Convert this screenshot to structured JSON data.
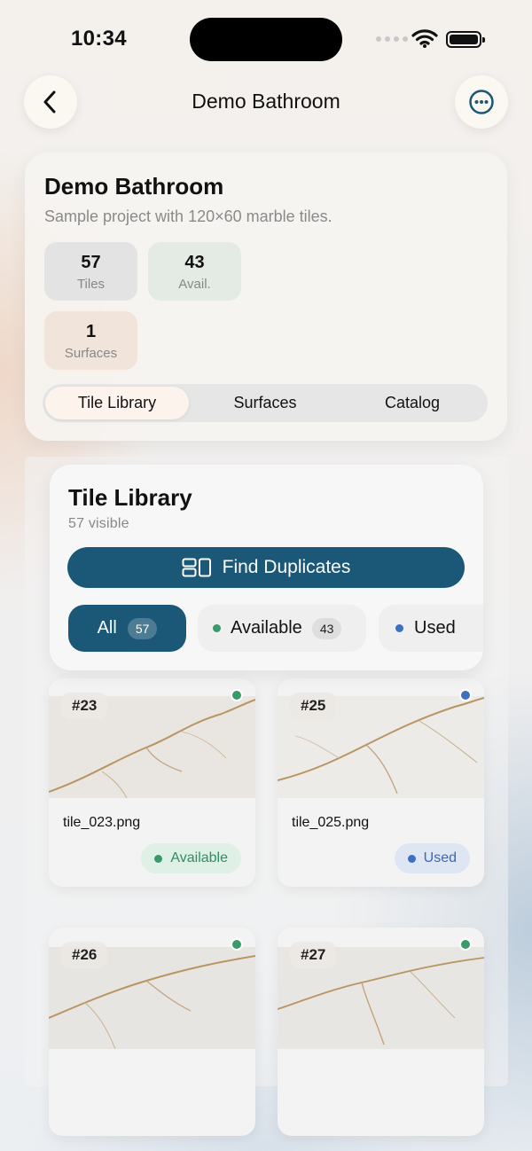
{
  "status_bar": {
    "time": "10:34"
  },
  "nav": {
    "title": "Demo Bathroom",
    "back_icon": "chevron-left-icon",
    "more_icon": "ellipsis-circle-icon"
  },
  "project": {
    "title": "Demo Bathroom",
    "description": "Sample project with 120×60 marble tiles.",
    "stats": [
      {
        "value": "57",
        "label": "Tiles"
      },
      {
        "value": "43",
        "label": "Avail."
      },
      {
        "value": "1",
        "label": "Surfaces"
      }
    ],
    "tabs": [
      "Tile Library",
      "Surfaces",
      "Catalog"
    ],
    "selected_tab": "Tile Library"
  },
  "library": {
    "title": "Tile Library",
    "visible_count": "57 visible",
    "find_duplicates_label": "Find Duplicates",
    "filters": [
      {
        "label": "All",
        "count": "57"
      },
      {
        "label": "Available",
        "count": "43"
      },
      {
        "label": "Used"
      }
    ],
    "selected_filter": "All"
  },
  "tiles": [
    {
      "number": "#23",
      "filename": "tile_023.png",
      "status": "Available"
    },
    {
      "number": "#25",
      "filename": "tile_025.png",
      "status": "Used"
    },
    {
      "number": "#26"
    },
    {
      "number": "#27"
    }
  ],
  "colors": {
    "accent": "#1b5777",
    "available": "#3a9a69",
    "used": "#3d70c0"
  }
}
